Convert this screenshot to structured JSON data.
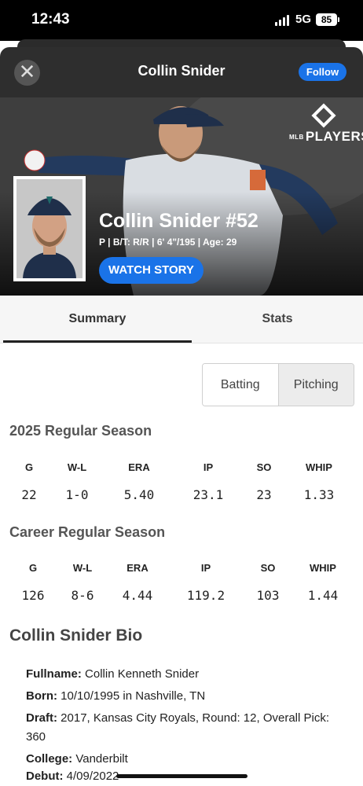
{
  "status_bar": {
    "time": "12:43",
    "network": "5G",
    "battery": "85"
  },
  "header": {
    "title": "Collin Snider",
    "follow_label": "Follow",
    "close_symbol": "✕"
  },
  "hero": {
    "logo_text": "PLAYERS",
    "logo_prefix": "MLB",
    "player_name": "Collin Snider #52",
    "meta": "P | B/T: R/R | 6' 4\"/195 | Age: 29",
    "watch_label": "WATCH STORY"
  },
  "tabs": [
    {
      "label": "Summary"
    },
    {
      "label": "Stats"
    }
  ],
  "toggle": {
    "batting": "Batting",
    "pitching": "Pitching"
  },
  "season": {
    "title": "2025 Regular Season",
    "headers": [
      "G",
      "W-L",
      "ERA",
      "IP",
      "SO",
      "WHIP"
    ],
    "values": [
      "22",
      "1-0",
      "5.40",
      "23.1",
      "23",
      "1.33"
    ]
  },
  "career": {
    "title": "Career Regular Season",
    "headers": [
      "G",
      "W-L",
      "ERA",
      "IP",
      "SO",
      "WHIP"
    ],
    "values": [
      "126",
      "8-6",
      "4.44",
      "119.2",
      "103",
      "1.44"
    ]
  },
  "bio": {
    "title": "Collin Snider Bio",
    "items": [
      {
        "label": "Fullname:",
        "value": "Collin Kenneth Snider"
      },
      {
        "label": "Born:",
        "value": "10/10/1995 in Nashville, TN"
      },
      {
        "label": "Draft:",
        "value": "2017, Kansas City Royals, Round: 12, Overall Pick: 360"
      },
      {
        "label": "College:",
        "value": "Vanderbilt"
      },
      {
        "label": "Debut:",
        "value": "4/09/2022"
      }
    ]
  }
}
